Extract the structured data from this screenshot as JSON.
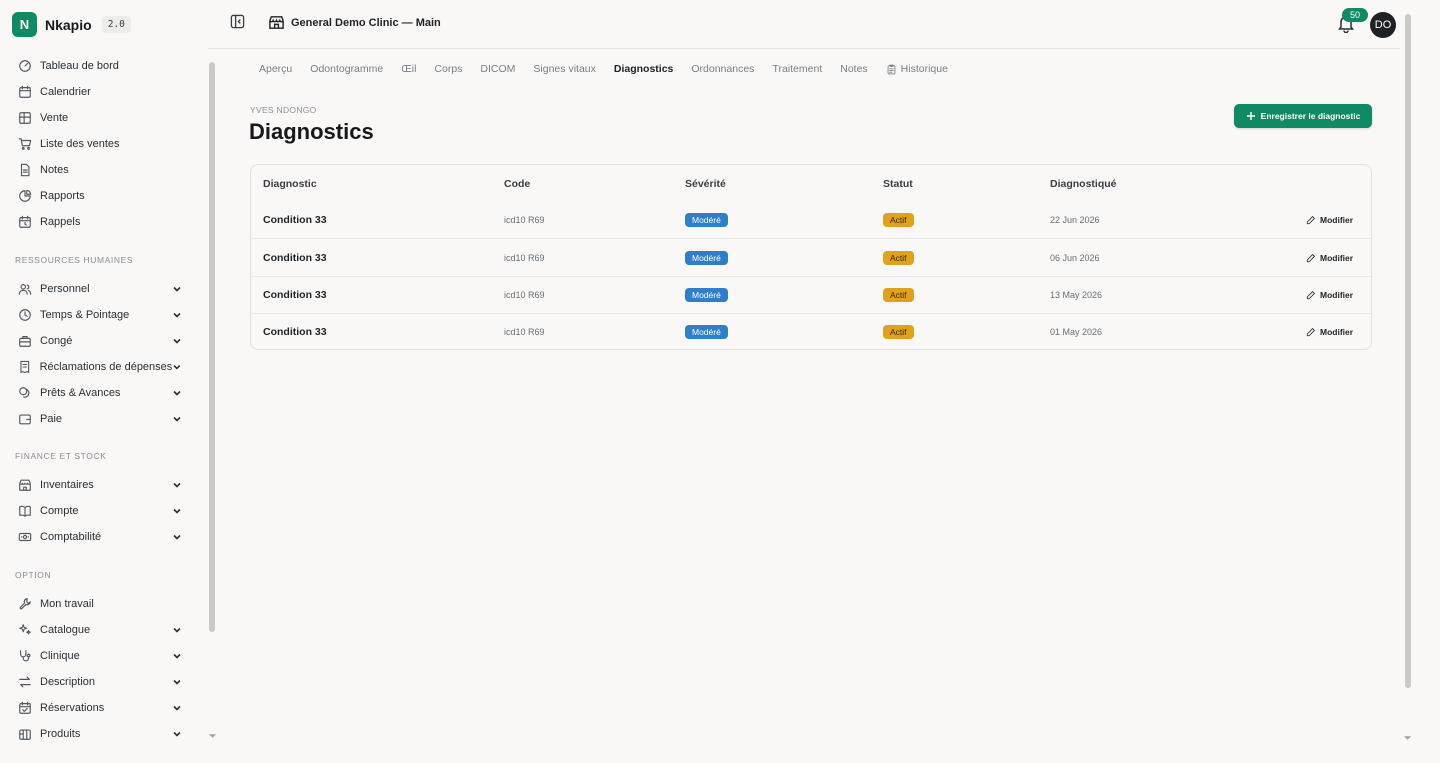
{
  "app": {
    "name": "Nkapio",
    "version": "2.0"
  },
  "sidebar": {
    "main_items": [
      {
        "label": "Tableau de bord",
        "icon": "dashboard-icon"
      },
      {
        "label": "Calendrier",
        "icon": "calendar-icon"
      },
      {
        "label": "Vente",
        "icon": "grid-icon"
      },
      {
        "label": "Liste des ventes",
        "icon": "cart-icon"
      },
      {
        "label": "Notes",
        "icon": "document-icon"
      },
      {
        "label": "Rapports",
        "icon": "pie-chart-icon"
      },
      {
        "label": "Rappels",
        "icon": "calendar-clock-icon"
      }
    ],
    "sections": [
      {
        "title": "RESSOURCES HUMAINES",
        "items": [
          {
            "label": "Personnel",
            "icon": "users-icon"
          },
          {
            "label": "Temps & Pointage",
            "icon": "clock-icon"
          },
          {
            "label": "Congé",
            "icon": "briefcase-icon"
          },
          {
            "label": "Réclamations de dépenses",
            "icon": "receipt-icon"
          },
          {
            "label": "Prêts & Avances",
            "icon": "coins-icon"
          },
          {
            "label": "Paie",
            "icon": "wallet-icon"
          }
        ]
      },
      {
        "title": "FINANCE ET STOCK",
        "items": [
          {
            "label": "Inventaires",
            "icon": "store-icon"
          },
          {
            "label": "Compte",
            "icon": "book-icon"
          },
          {
            "label": "Comptabilité",
            "icon": "banknote-icon"
          }
        ]
      },
      {
        "title": "OPTION",
        "items": [
          {
            "label": "Mon travail",
            "icon": "wrench-icon"
          },
          {
            "label": "Catalogue",
            "icon": "sparkles-icon"
          },
          {
            "label": "Clinique",
            "icon": "stethoscope-icon"
          },
          {
            "label": "Description",
            "icon": "swap-icon"
          },
          {
            "label": "Réservations",
            "icon": "calendar-check-icon"
          },
          {
            "label": "Produits",
            "icon": "package-icon"
          }
        ]
      }
    ]
  },
  "header": {
    "clinic_name": "General Demo Clinic — Main",
    "notifications_count": "50",
    "avatar_initials": "DO"
  },
  "tabs": [
    {
      "label": "Aperçu",
      "active": false
    },
    {
      "label": "Odontogramme",
      "active": false
    },
    {
      "label": "Œil",
      "active": false
    },
    {
      "label": "Corps",
      "active": false
    },
    {
      "label": "DICOM",
      "active": false
    },
    {
      "label": "Signes vitaux",
      "active": false
    },
    {
      "label": "Diagnostics",
      "active": true
    },
    {
      "label": "Ordonnances",
      "active": false
    },
    {
      "label": "Traitement",
      "active": false
    },
    {
      "label": "Notes",
      "active": false
    },
    {
      "label": "Historique",
      "active": false,
      "icon": "clipboard-icon"
    }
  ],
  "page": {
    "patient_name": "YVES NDONGO",
    "title": "Diagnostics",
    "save_button": "Enregistrer le diagnostic"
  },
  "table": {
    "columns": [
      "Diagnostic",
      "Code",
      "Sévérité",
      "Statut",
      "Diagnostiqué"
    ],
    "edit_label": "Modifier",
    "rows": [
      {
        "diagnostic": "Condition 33",
        "code": "icd10 R69",
        "severity": "Modéré",
        "status": "Actif",
        "date": "22 Jun 2026"
      },
      {
        "diagnostic": "Condition 33",
        "code": "icd10 R69",
        "severity": "Modéré",
        "status": "Actif",
        "date": "06 Jun 2026"
      },
      {
        "diagnostic": "Condition 33",
        "code": "icd10 R69",
        "severity": "Modéré",
        "status": "Actif",
        "date": "13 May 2026"
      },
      {
        "diagnostic": "Condition 33",
        "code": "icd10 R69",
        "severity": "Modéré",
        "status": "Actif",
        "date": "01 May 2026"
      }
    ]
  },
  "colors": {
    "brand": "#0f8a64",
    "severity_badge": "#2f7ec9",
    "status_badge": "#e0a11b",
    "background": "#f9f8f6"
  }
}
